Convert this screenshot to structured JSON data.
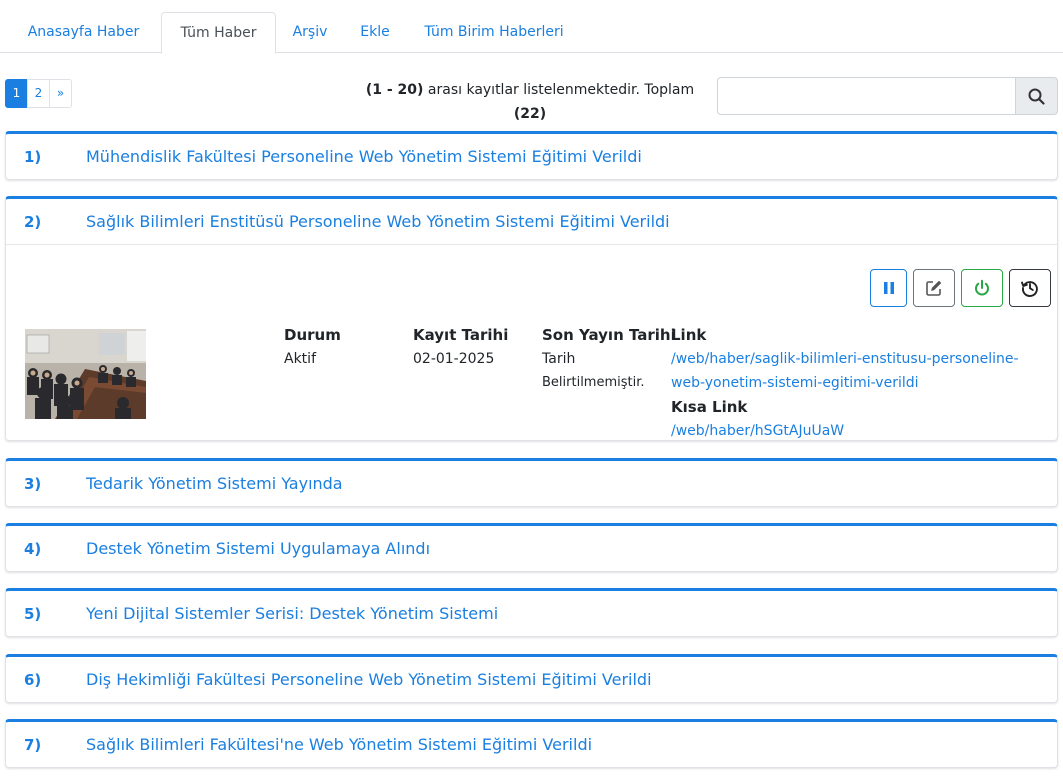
{
  "tabs": [
    {
      "label": "Anasayfa Haber",
      "active": false
    },
    {
      "label": "Tüm Haber",
      "active": true
    },
    {
      "label": "Arşiv",
      "active": false
    },
    {
      "label": "Ekle",
      "active": false
    },
    {
      "label": "Tüm Birim Haberleri",
      "active": false
    }
  ],
  "pagination": {
    "pages": [
      "1",
      "2"
    ],
    "current": "1",
    "next": "»"
  },
  "records": {
    "range": "(1 - 20)",
    "text": "arası kayıtlar listelenmektedir. Toplam",
    "total": "(22)"
  },
  "search": {
    "placeholder": "",
    "value": "",
    "icon": "search-icon"
  },
  "items": [
    {
      "num": "1)",
      "title": "Mühendislik Fakültesi Personeline Web Yönetim Sistemi Eğitimi Verildi"
    },
    {
      "num": "2)",
      "title": "Sağlık Bilimleri Enstitüsü Personeline Web Yönetim Sistemi Eğitimi Verildi"
    },
    {
      "num": "3)",
      "title": "Tedarik Yönetim Sistemi Yayında"
    },
    {
      "num": "4)",
      "title": "Destek Yönetim Sistemi Uygulamaya Alındı"
    },
    {
      "num": "5)",
      "title": "Yeni Dijital Sistemler Serisi: Destek Yönetim Sistemi"
    },
    {
      "num": "6)",
      "title": "Diş Hekimliği Fakültesi Personeline Web Yönetim Sistemi Eğitimi Verildi"
    },
    {
      "num": "7)",
      "title": "Sağlık Bilimleri Fakültesi'ne Web Yönetim Sistemi Eğitimi Verildi"
    }
  ],
  "detail": {
    "actions": [
      "pause-icon",
      "edit-icon",
      "power-icon",
      "history-icon"
    ],
    "durum_label": "Durum",
    "durum_value": "Aktif",
    "kayit_label": "Kayıt Tarihi",
    "kayit_value": "02-01-2025",
    "yayin_label": "Son Yayın Tarihi",
    "yayin_value_1": "Tarih",
    "yayin_value_2": "Belirtilmemiştir.",
    "link_label": "Link",
    "link_value_1": "/web/haber/saglik-bilimleri-enstitusu-personeline-",
    "link_value_2": "web-yonetim-sistemi-egitimi-verildi",
    "kisa_label": "Kısa Link",
    "kisa_value": "/web/haber/hSGtAJuUaW"
  },
  "colors": {
    "accent": "#1a7fe0",
    "success": "#28a745",
    "secondary": "#6c757d",
    "dark": "#343a40"
  }
}
